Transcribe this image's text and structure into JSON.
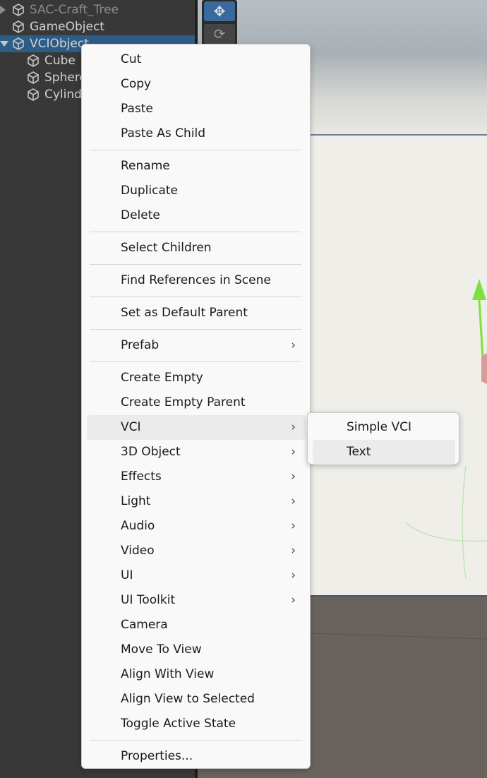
{
  "hierarchy": {
    "rows": [
      {
        "label": "SAC-Craft_Tree",
        "indent": 0,
        "expander": "collapsed",
        "dim": true,
        "selected": false
      },
      {
        "label": "GameObject",
        "indent": 0,
        "expander": "none",
        "dim": false,
        "selected": false
      },
      {
        "label": "VCIObject",
        "indent": 0,
        "expander": "expanded",
        "dim": false,
        "selected": true
      },
      {
        "label": "Cube",
        "indent": 1,
        "expander": "none",
        "dim": false,
        "selected": false
      },
      {
        "label": "Sphere",
        "indent": 1,
        "expander": "none",
        "dim": false,
        "selected": false
      },
      {
        "label": "Cylinder",
        "indent": 1,
        "expander": "none",
        "dim": false,
        "selected": false
      }
    ]
  },
  "scene": {
    "tools": [
      {
        "name": "move-tool",
        "glyph": "✥",
        "active": true
      },
      {
        "name": "rotate-tool",
        "glyph": "⟳",
        "active": false
      }
    ]
  },
  "context_menu": {
    "groups": [
      [
        {
          "label": "Cut"
        },
        {
          "label": "Copy"
        },
        {
          "label": "Paste"
        },
        {
          "label": "Paste As Child"
        }
      ],
      [
        {
          "label": "Rename"
        },
        {
          "label": "Duplicate"
        },
        {
          "label": "Delete"
        }
      ],
      [
        {
          "label": "Select Children"
        }
      ],
      [
        {
          "label": "Find References in Scene"
        }
      ],
      [
        {
          "label": "Set as Default Parent"
        }
      ],
      [
        {
          "label": "Prefab",
          "submenu": true
        }
      ],
      [
        {
          "label": "Create Empty"
        },
        {
          "label": "Create Empty Parent"
        },
        {
          "label": "VCI",
          "submenu": true,
          "highlighted": true
        },
        {
          "label": "3D Object",
          "submenu": true
        },
        {
          "label": "Effects",
          "submenu": true
        },
        {
          "label": "Light",
          "submenu": true
        },
        {
          "label": "Audio",
          "submenu": true
        },
        {
          "label": "Video",
          "submenu": true
        },
        {
          "label": "UI",
          "submenu": true
        },
        {
          "label": "UI Toolkit",
          "submenu": true
        },
        {
          "label": "Camera"
        },
        {
          "label": "Move To View"
        },
        {
          "label": "Align With View"
        },
        {
          "label": "Align View to Selected"
        },
        {
          "label": "Toggle Active State"
        }
      ],
      [
        {
          "label": "Properties..."
        }
      ]
    ]
  },
  "vci_submenu": {
    "items": [
      {
        "label": "Simple VCI",
        "highlighted": false
      },
      {
        "label": "Text",
        "highlighted": true
      }
    ]
  },
  "colors": {
    "selection": "#2c5d87",
    "menu_bg": "#f9f9f9",
    "menu_hover": "#ebebeb",
    "gizmo_green": "#7ee040"
  }
}
